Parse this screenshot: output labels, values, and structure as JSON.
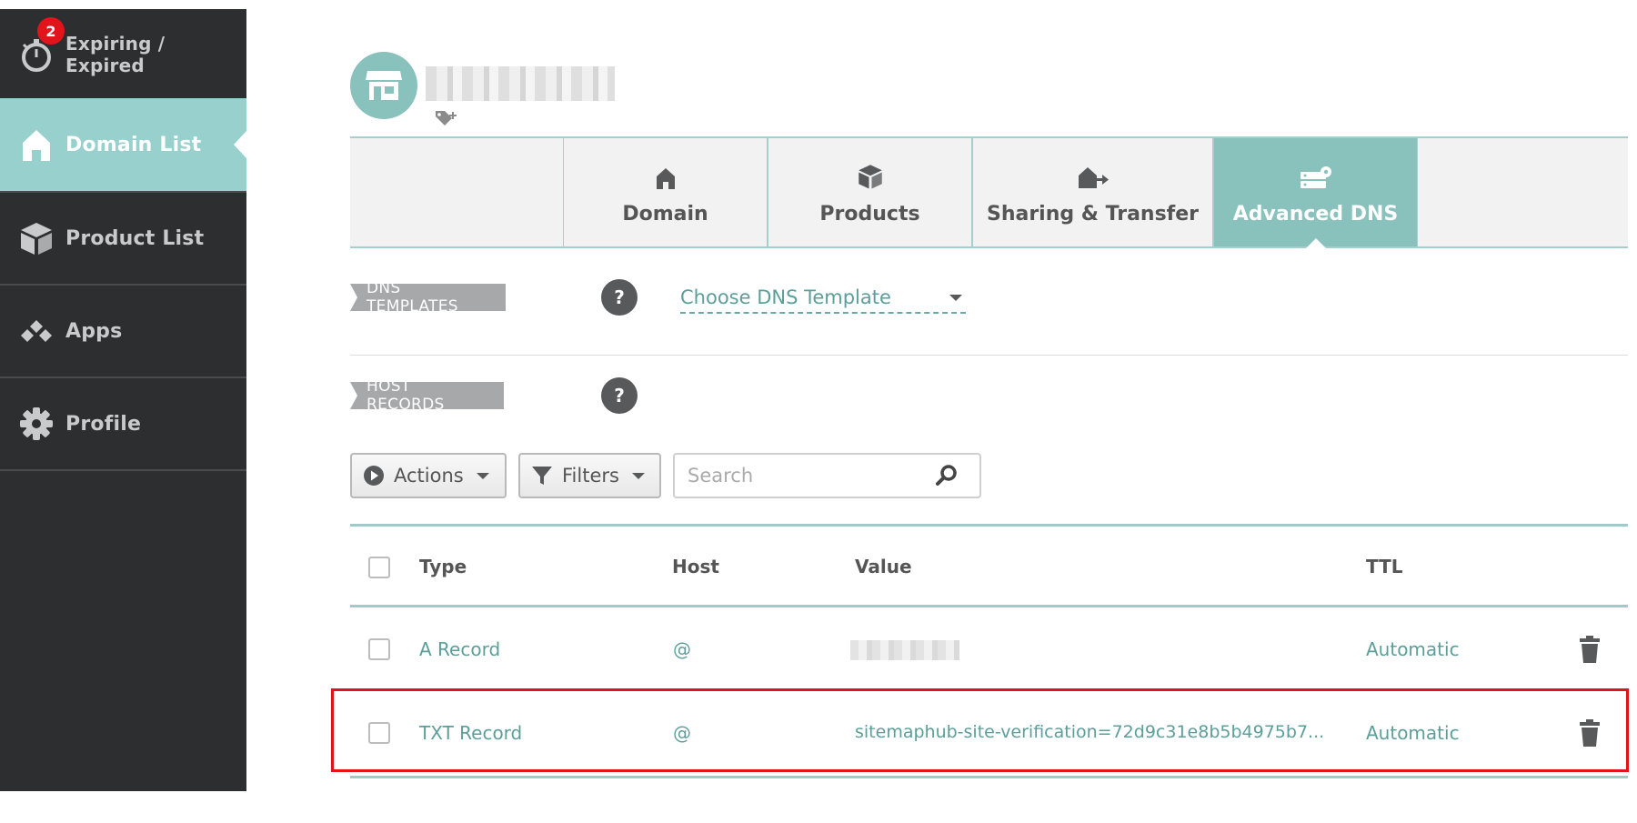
{
  "sidebar": {
    "items": [
      {
        "label": "Expiring / Expired",
        "icon": "stopwatch-icon",
        "badge": "2"
      },
      {
        "label": "Domain List",
        "icon": "home-icon"
      },
      {
        "label": "Product List",
        "icon": "box-icon"
      },
      {
        "label": "Apps",
        "icon": "apps-icon"
      },
      {
        "label": "Profile",
        "icon": "gear-icon"
      }
    ]
  },
  "header": {
    "store_icon": "store-icon",
    "tag_icon": "tag-plus-icon"
  },
  "tabs": [
    {
      "label": "Domain",
      "icon": "home-icon"
    },
    {
      "label": "Products",
      "icon": "box-icon"
    },
    {
      "label": "Sharing & Transfer",
      "icon": "house-transfer-icon"
    },
    {
      "label": "Advanced DNS",
      "icon": "server-gear-icon"
    }
  ],
  "dns_templates": {
    "label": "DNS TEMPLATES",
    "help": "?",
    "select_value": "Choose DNS Template"
  },
  "host_records": {
    "label": "HOST RECORDS",
    "help": "?"
  },
  "toolbar": {
    "actions_label": "Actions",
    "filters_label": "Filters",
    "search_placeholder": "Search"
  },
  "table": {
    "columns": {
      "type": "Type",
      "host": "Host",
      "value": "Value",
      "ttl": "TTL"
    },
    "rows": [
      {
        "type": "A Record",
        "host": "@",
        "value": "",
        "ttl": "Automatic"
      },
      {
        "type": "TXT Record",
        "host": "@",
        "value": "sitemaphub-site-verification=72d9c31e8b5b4975b7...",
        "ttl": "Automatic"
      }
    ]
  },
  "colors": {
    "accent": "#89c1bd",
    "sidebar": "#2d2e30",
    "highlight": "#e3131c",
    "badge": "#e3131c"
  }
}
